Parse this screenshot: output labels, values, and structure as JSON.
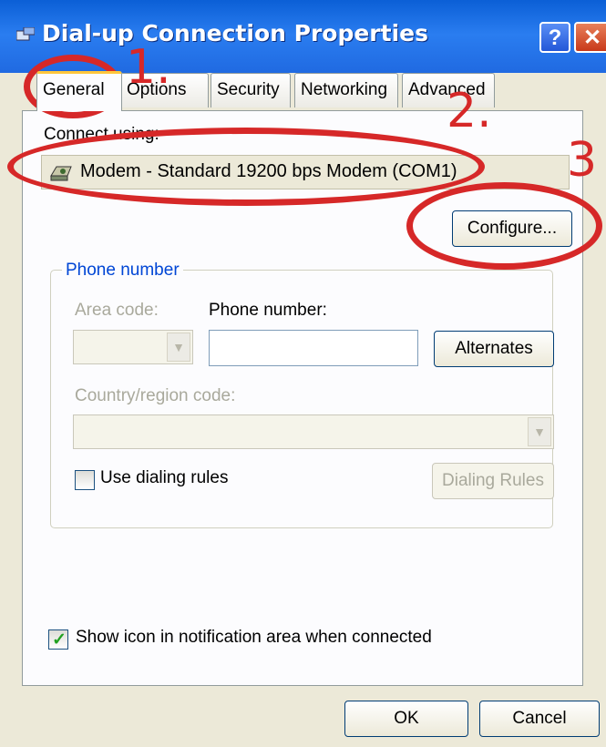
{
  "window": {
    "title": "Dial-up Connection Properties",
    "help_label": "?",
    "close_label": "✕"
  },
  "tabs": [
    {
      "label": "General",
      "active": true
    },
    {
      "label": "Options",
      "active": false
    },
    {
      "label": "Security",
      "active": false
    },
    {
      "label": "Networking",
      "active": false
    },
    {
      "label": "Advanced",
      "active": false
    }
  ],
  "general": {
    "connect_using_label": "Connect using:",
    "device_name": "Modem - Standard 19200 bps Modem (COM1)",
    "configure_label": "Configure...",
    "phone_group_label": "Phone number",
    "area_code_label": "Area code:",
    "area_code_value": "",
    "phone_number_label": "Phone number:",
    "phone_number_value": "",
    "alternates_label": "Alternates",
    "country_code_label": "Country/region code:",
    "country_code_value": "",
    "use_dialing_rules_label": "Use dialing rules",
    "use_dialing_rules_checked": false,
    "dialing_rules_label": "Dialing Rules",
    "show_icon_label": "Show icon in notification area when connected",
    "show_icon_checked": true
  },
  "footer": {
    "ok_label": "OK",
    "cancel_label": "Cancel"
  },
  "annotations": [
    "1.",
    "2.",
    "3"
  ],
  "colors": {
    "titlebar": "#1f68e0",
    "dialog_bg": "#ece9d8",
    "annotation": "#d62828"
  },
  "icons": [
    "connection-icon",
    "modem-icon",
    "dropdown-arrow-icon",
    "check-icon"
  ]
}
